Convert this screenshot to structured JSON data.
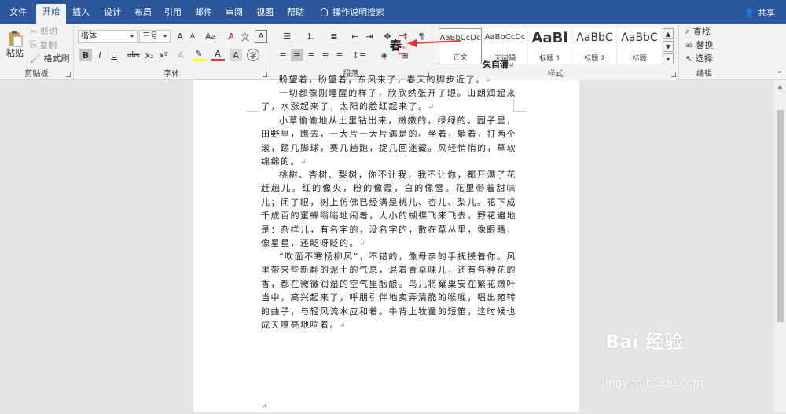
{
  "tabs": [
    "文件",
    "开始",
    "插入",
    "设计",
    "布局",
    "引用",
    "邮件",
    "审阅",
    "视图",
    "帮助"
  ],
  "tell_me": "操作说明搜索",
  "share": "共享",
  "clipboard": {
    "paste": "粘贴",
    "cut": "剪切",
    "copy": "复制",
    "format_painter": "格式刷",
    "label": "剪贴板"
  },
  "font": {
    "name": "楷体",
    "size": "三号",
    "grow": "A",
    "shrink": "A",
    "case": "Aa",
    "bold": "B",
    "italic": "I",
    "underline": "U",
    "strike": "abc",
    "sub": "x₂",
    "sup": "x²",
    "label": "字体"
  },
  "paragraph": {
    "label": "段落"
  },
  "styles": {
    "label": "样式",
    "items": [
      {
        "sample": "AaBbCcDc",
        "name": "正文"
      },
      {
        "sample": "AaBbCcDc",
        "name": "无间隔"
      },
      {
        "sample": "AaBl",
        "name": "标题 1"
      },
      {
        "sample": "AaBbC",
        "name": "标题 2"
      },
      {
        "sample": "AaBbC",
        "name": "标题"
      }
    ]
  },
  "editing": {
    "find": "查找",
    "replace": "替换",
    "select": "选择",
    "label": "编辑"
  },
  "document": {
    "title": "春",
    "author": "朱自清",
    "paragraphs": [
      "盼望着，盼望着，东风来了，春天的脚步近了。",
      "一切都像刚睡醒的样子，欣欣然张开了眼。山朗润起来了，水涨起来了，太阳的脸红起来了。",
      "小草偷偷地从土里钻出来，嫩嫩的，绿绿的。园子里，田野里，瞧去，一大片一大片满是的。坐着，躺着，打两个滚，踢几脚球，赛几趟跑，捉几回迷藏。风轻悄悄的，草软绵绵的。",
      "桃树、杏树、梨树，你不让我，我不让你，都开满了花赶趟儿。红的像火，粉的像霞，白的像雪。花里带着甜味儿；闭了眼，树上仿佛已经满是桃儿、杏儿、梨儿。花下成千成百的蜜蜂嗡嗡地闹着，大小的蝴蝶飞来飞去。野花遍地是：杂样儿，有名字的，没名字的，散在草丛里，像眼睛，像星星，还眨呀眨的。",
      "“吹面不寒杨柳风”，不错的，像母亲的手抚摸着你。风里带来些新翻的泥土的气息，混着青草味儿，还有各种花的香，都在微微润湿的空气里酝酿。鸟儿将窠巢安在繁花嫩叶当中，高兴起来了，呼朋引伴地卖弄清脆的喉咙，唱出宛转的曲子，与轻风流水应和着。牛背上牧童的短笛，这时候也成天嘹亮地响着。"
    ],
    "return_mark": "↵"
  },
  "watermark": {
    "brand": "Bai 经验",
    "url": "jingyan.baidu.com"
  }
}
